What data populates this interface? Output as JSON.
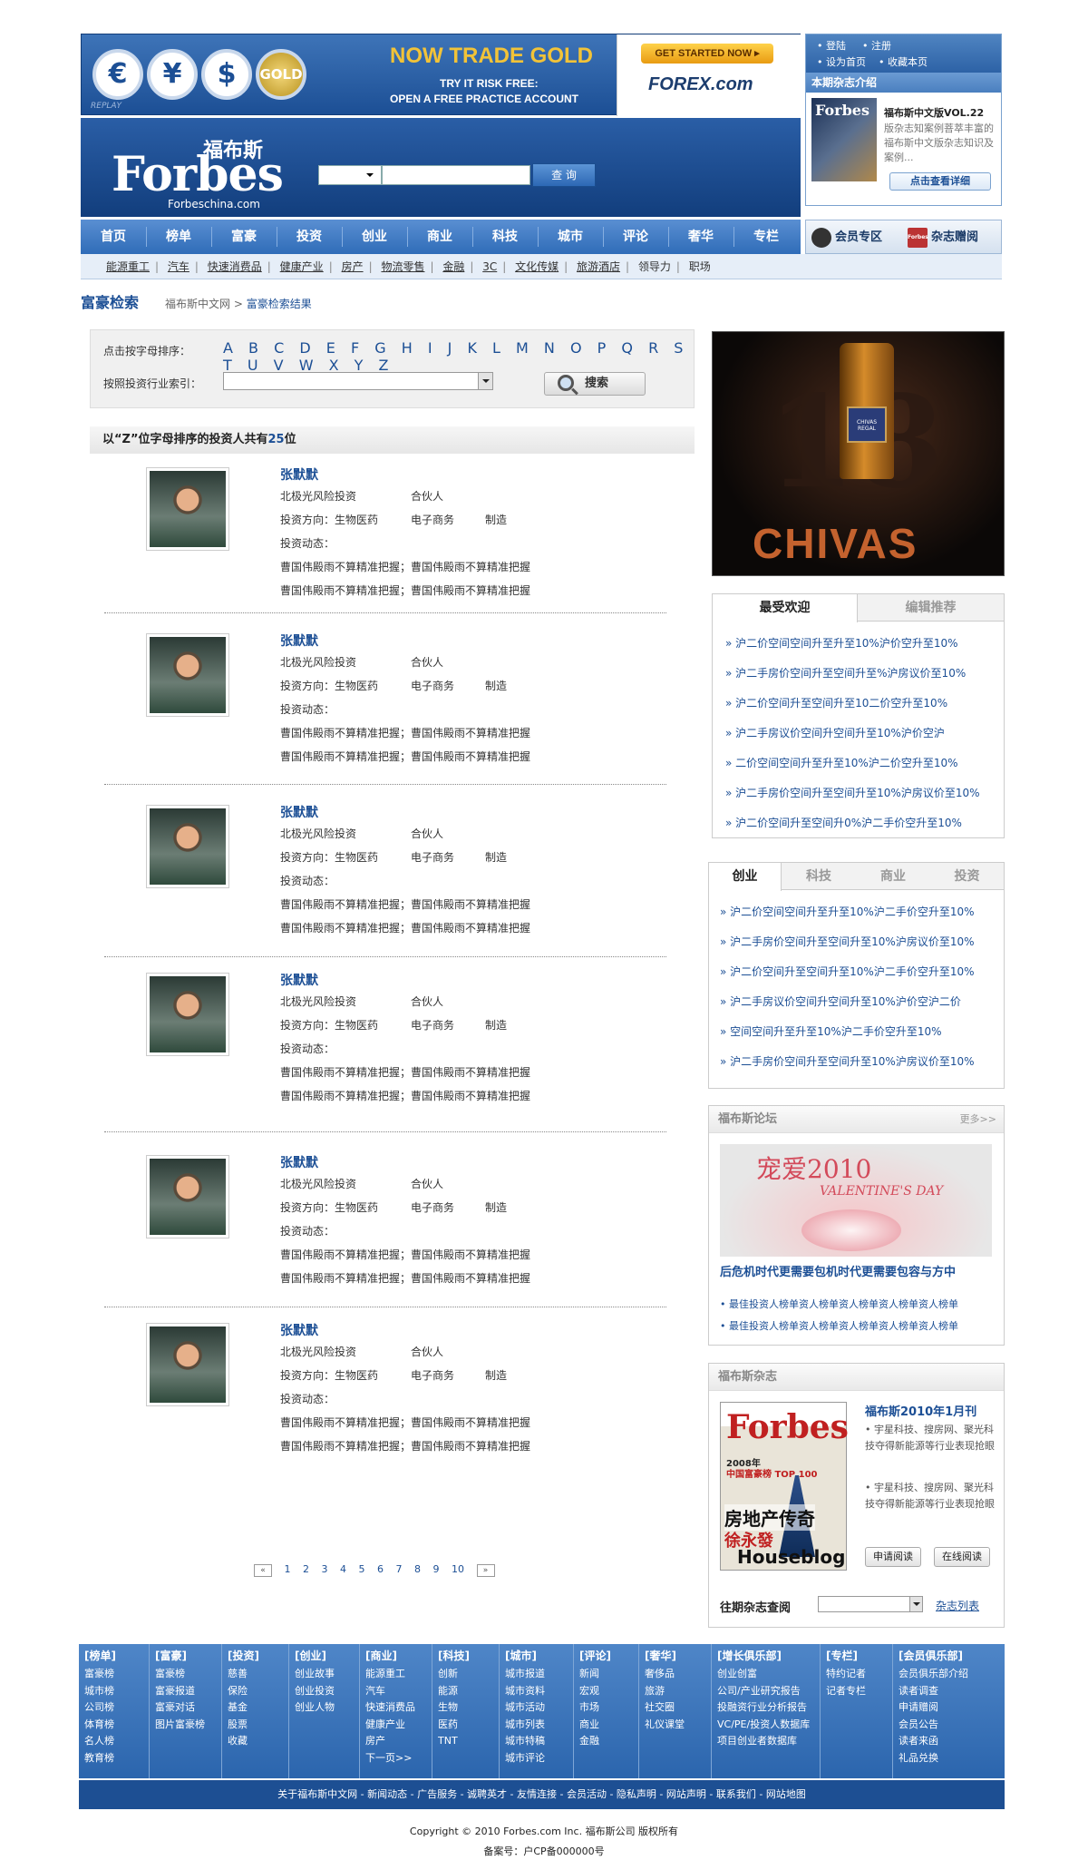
{
  "banner": {
    "coins": [
      "€",
      "¥",
      "$",
      "GOLD"
    ],
    "replay": "REPLAY",
    "headline": "NOW TRADE GOLD",
    "line1": "TRY IT RISK FREE:",
    "line2": "OPEN A FREE PRACTICE ACCOUNT",
    "cta": "GET STARTED NOW ▸",
    "brand": "FOREX.com"
  },
  "topbox": {
    "links": [
      "• 登陆",
      "• 注册",
      "• 设为首页",
      "• 收藏本页"
    ],
    "title": "本期杂志介绍",
    "cover_text": "Forbes",
    "issue": "福布斯中文版VOL.22",
    "desc": "版杂志知案例菩萃丰富的福布斯中文版杂志知识及案例...",
    "button": "点击查看详细"
  },
  "header": {
    "logo_cn": "福布斯",
    "logo_en": "Forbes",
    "logo_url": "Forbeschina.com",
    "search_button": "查 询"
  },
  "nav": {
    "items": [
      "首页",
      "榜单",
      "富豪",
      "投资",
      "创业",
      "商业",
      "科技",
      "城市",
      "评论",
      "奢华",
      "专栏"
    ],
    "member": "会员专区",
    "gift": "杂志赠阅",
    "gift_icon_text": "Forbes"
  },
  "subnav": [
    "能源重工",
    "汽车",
    "快速消费品",
    "健康产业",
    "房产",
    "物流零售",
    "金融",
    "3C",
    "文化传媒",
    "旅游酒店",
    "领导力",
    "职场"
  ],
  "breadcrumb": {
    "title": "富豪检索",
    "home": "福布斯中文网",
    "sep": ">",
    "current": "富豪检索结果"
  },
  "filter": {
    "letters_label": "点击按字母排序：",
    "letters": "A B C D E F G H I J K L M N O P Q R S T U V W X Y Z",
    "industry_label": "按照投资行业索引：",
    "search_button": "搜索"
  },
  "count": {
    "prefix": "以“Z”位字母排序的投资人共有",
    "num": "25",
    "suffix": "位"
  },
  "people": [
    {
      "name": "张默默",
      "org": "北极光风险投资",
      "role": "合伙人",
      "dir_label": "投资方向：",
      "dir1": "生物医药",
      "dir2": "电子商务",
      "dir3": "制造",
      "news": "投资动态：",
      "t1": "曹国伟殿雨不算精准把握；曹国伟殿雨不算精准把握",
      "t2": "曹国伟殿雨不算精准把握；曹国伟殿雨不算精准把握"
    },
    {
      "name": "张默默",
      "org": "北极光风险投资",
      "role": "合伙人",
      "dir_label": "投资方向：",
      "dir1": "生物医药",
      "dir2": "电子商务",
      "dir3": "制造",
      "news": "投资动态：",
      "t1": "曹国伟殿雨不算精准把握；曹国伟殿雨不算精准把握",
      "t2": "曹国伟殿雨不算精准把握；曹国伟殿雨不算精准把握"
    },
    {
      "name": "张默默",
      "org": "北极光风险投资",
      "role": "合伙人",
      "dir_label": "投资方向：",
      "dir1": "生物医药",
      "dir2": "电子商务",
      "dir3": "制造",
      "news": "投资动态：",
      "t1": "曹国伟殿雨不算精准把握；曹国伟殿雨不算精准把握",
      "t2": "曹国伟殿雨不算精准把握；曹国伟殿雨不算精准把握"
    },
    {
      "name": "张默默",
      "org": "北极光风险投资",
      "role": "合伙人",
      "dir_label": "投资方向：",
      "dir1": "生物医药",
      "dir2": "电子商务",
      "dir3": "制造",
      "news": "投资动态：",
      "t1": "曹国伟殿雨不算精准把握；曹国伟殿雨不算精准把握",
      "t2": "曹国伟殿雨不算精准把握；曹国伟殿雨不算精准把握"
    },
    {
      "name": "张默默",
      "org": "北极光风险投资",
      "role": "合伙人",
      "dir_label": "投资方向：",
      "dir1": "生物医药",
      "dir2": "电子商务",
      "dir3": "制造",
      "news": "投资动态：",
      "t1": "曹国伟殿雨不算精准把握；曹国伟殿雨不算精准把握",
      "t2": "曹国伟殿雨不算精准把握；曹国伟殿雨不算精准把握"
    },
    {
      "name": "张默默",
      "org": "北极光风险投资",
      "role": "合伙人",
      "dir_label": "投资方向：",
      "dir1": "生物医药",
      "dir2": "电子商务",
      "dir3": "制造",
      "news": "投资动态：",
      "t1": "曹国伟殿雨不算精准把握；曹国伟殿雨不算精准把握",
      "t2": "曹国伟殿雨不算精准把握；曹国伟殿雨不算精准把握"
    }
  ],
  "pager": {
    "prev": "«",
    "pages": [
      "1",
      "2",
      "3",
      "4",
      "5",
      "6",
      "7",
      "8",
      "9",
      "10"
    ],
    "next": "»"
  },
  "ad": {
    "number": "18",
    "bottle_label": "CHIVAS REGAL",
    "word": "CHIVAS"
  },
  "popular": {
    "tab_on": "最受欢迎",
    "tab_off": "编辑推荐",
    "items": [
      "沪二价空间空间升至升至10%沪价空升至10%",
      "沪二手房价空间升至空间升至%沪房议价至10%",
      "沪二价空间升至空间升至10二价空升至10%",
      "沪二手房议价空间升空间升至10%沪价空沪",
      "二价空间空间升至升至10%沪二价空升至10%",
      "沪二手房价空间升至空间升至10%沪房议价至10%",
      "沪二价空间升至空间升0%沪二手价空升至10%"
    ]
  },
  "cats": {
    "tabs": [
      "创业",
      "科技",
      "商业",
      "投资"
    ],
    "items": [
      "沪二价空间空间升至升至10%沪二手价空升至10%",
      "沪二手房价空间升至空间升至10%沪房议价至10%",
      "沪二价空间升至空间升至10%沪二手价空升至10%",
      "沪二手房议价空间升空间升至10%沪价空沪二价",
      "空间空间升至升至10%沪二手价空升至10%",
      "沪二手房价空间升至空间升至10%沪房议价至10%"
    ]
  },
  "forum": {
    "title": "福布斯论坛",
    "more": "更多>>",
    "img_title": "宠爱2010",
    "img_sub": "VALENTINE'S DAY",
    "headline": "后危机时代更需要包机时代更需要包容与方中",
    "items": [
      "最佳投资人榜单资人榜单资人榜单资人榜单资人榜单",
      "最佳投资人榜单资人榜单资人榜单资人榜单资人榜单"
    ]
  },
  "mag": {
    "title": "福布斯杂志",
    "cover_brand": "Forbes",
    "cover_year": "2008年",
    "cover_list": "中国富豪榜 TOP 100",
    "cover_head": "房地产传奇",
    "cover_name": "徐永發",
    "cover_hb": "Houseblog",
    "issue": "福布斯2010年1月刊",
    "p1": "• 宇星科技、搜房网、聚光科技夺得新能源等行业表现抢眼",
    "p2": "• 宇星科技、搜房网、聚光科技夺得新能源等行业表现抢眼",
    "btn_apply": "申请阅读",
    "btn_online": "在线阅读",
    "past_label": "往期杂志查阅",
    "list_link": "杂志列表"
  },
  "footer": {
    "cols": [
      {
        "h": "[榜单]",
        "l": [
          "富豪榜",
          "城市榜",
          "公司榜",
          "体育榜",
          "名人榜",
          "教育榜"
        ]
      },
      {
        "h": "[富豪]",
        "l": [
          "富豪榜",
          "富豪报道",
          "富豪对话",
          "图片富豪榜"
        ]
      },
      {
        "h": "[投资]",
        "l": [
          "慈善",
          "保险",
          "基金",
          "股票",
          "收藏"
        ]
      },
      {
        "h": "[创业]",
        "l": [
          "创业故事",
          "创业投资",
          "创业人物"
        ]
      },
      {
        "h": "[商业]",
        "l": [
          "能源重工",
          "汽车",
          "快速消费品",
          "健康产业",
          "房产",
          "下一页>>"
        ]
      },
      {
        "h": "[科技]",
        "l": [
          "创新",
          "能源",
          "生物",
          "医药",
          "TNT"
        ]
      },
      {
        "h": "[城市]",
        "l": [
          "城市报道",
          "城市资料",
          "城市活动",
          "城市列表",
          "城市特稿",
          "城市评论"
        ]
      },
      {
        "h": "[评论]",
        "l": [
          "新闻",
          "宏观",
          "市场",
          "商业",
          "金融"
        ]
      },
      {
        "h": "[奢华]",
        "l": [
          "奢侈品",
          "旅游",
          "社交圈",
          "礼仪课堂"
        ]
      },
      {
        "h": "[增长俱乐部]",
        "l": [
          "创业创富",
          "公司/产业研究报告",
          "投融资行业分析报告",
          "VC/PE/投资人数据库",
          "项目创业者数据库"
        ]
      },
      {
        "h": "[专栏]",
        "l": [
          "特约记者",
          "记者专栏"
        ]
      },
      {
        "h": "[会员俱乐部]",
        "l": [
          "会员俱乐部介绍",
          "读者调查",
          "申请赠阅",
          "会员公告",
          "读者来函",
          "礼品兑换"
        ]
      }
    ],
    "bar": "关于福布斯中文网 - 新闻动态 - 广告服务 - 诚聘英才 - 友情连接 - 会员活动 - 隐私声明 - 网站声明 - 联系我们 - 网站地图",
    "copyright": "Copyright © 2010 Forbes.com Inc. 福布斯公司 版权所有",
    "icp": "备案号：户CP备000000号"
  },
  "colors": {
    "brand_blue": "#1c4f95",
    "nav_blue": "#2f6cb8",
    "link_blue": "#1c4f95"
  }
}
